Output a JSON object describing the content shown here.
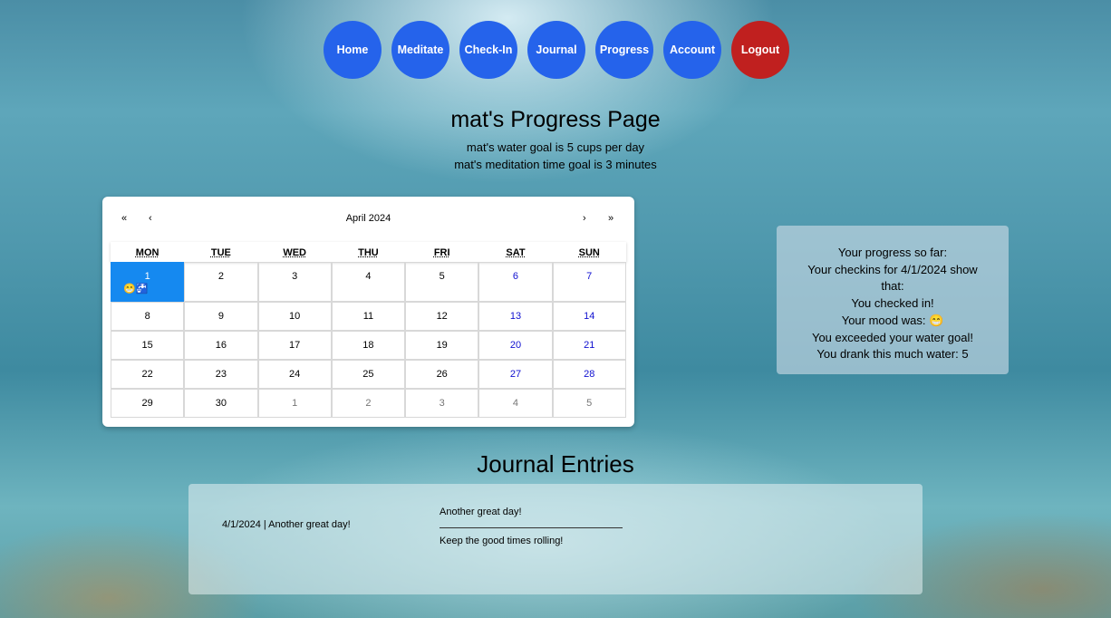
{
  "nav": {
    "home": "Home",
    "meditate": "Meditate",
    "checkin": "Check-In",
    "journal": "Journal",
    "progress": "Progress",
    "account": "Account",
    "logout": "Logout"
  },
  "colors": {
    "nav_button": "#2563eb",
    "logout_button": "#c0201f",
    "today_tile": "#1589f0",
    "weekend_text": "#1010d0"
  },
  "header": {
    "title": "mat's Progress Page",
    "water_goal": "mat's water goal is 5 cups per day",
    "meditation_goal": "mat's meditation time goal is 3 minutes"
  },
  "calendar": {
    "prev2": "«",
    "prev": "‹",
    "month": "April 2024",
    "next": "›",
    "next2": "»",
    "weekdays": [
      "MON",
      "TUE",
      "WED",
      "THU",
      "FRI",
      "SAT",
      "SUN"
    ],
    "weeks": [
      [
        "1",
        "2",
        "3",
        "4",
        "5",
        "6",
        "7"
      ],
      [
        "8",
        "9",
        "10",
        "11",
        "12",
        "13",
        "14"
      ],
      [
        "15",
        "16",
        "17",
        "18",
        "19",
        "20",
        "21"
      ],
      [
        "22",
        "23",
        "24",
        "25",
        "26",
        "27",
        "28"
      ],
      [
        "29",
        "30",
        "1",
        "2",
        "3",
        "4",
        "5"
      ]
    ],
    "marks_day1": "😁🚰"
  },
  "progress": {
    "heading": "Your progress so far:",
    "checkins": "Your checkins for 4/1/2024 show that:",
    "checked_in": "You checked in!",
    "mood": "Your mood was: 😁",
    "water_goal": "You exceeded your water goal!",
    "water_amount": "You drank this much water: 5"
  },
  "journal": {
    "title": "Journal Entries",
    "entry_link": "4/1/2024 | Another great day!",
    "entry_title": "Another great day!",
    "entry_body": "Keep the good times rolling!"
  }
}
